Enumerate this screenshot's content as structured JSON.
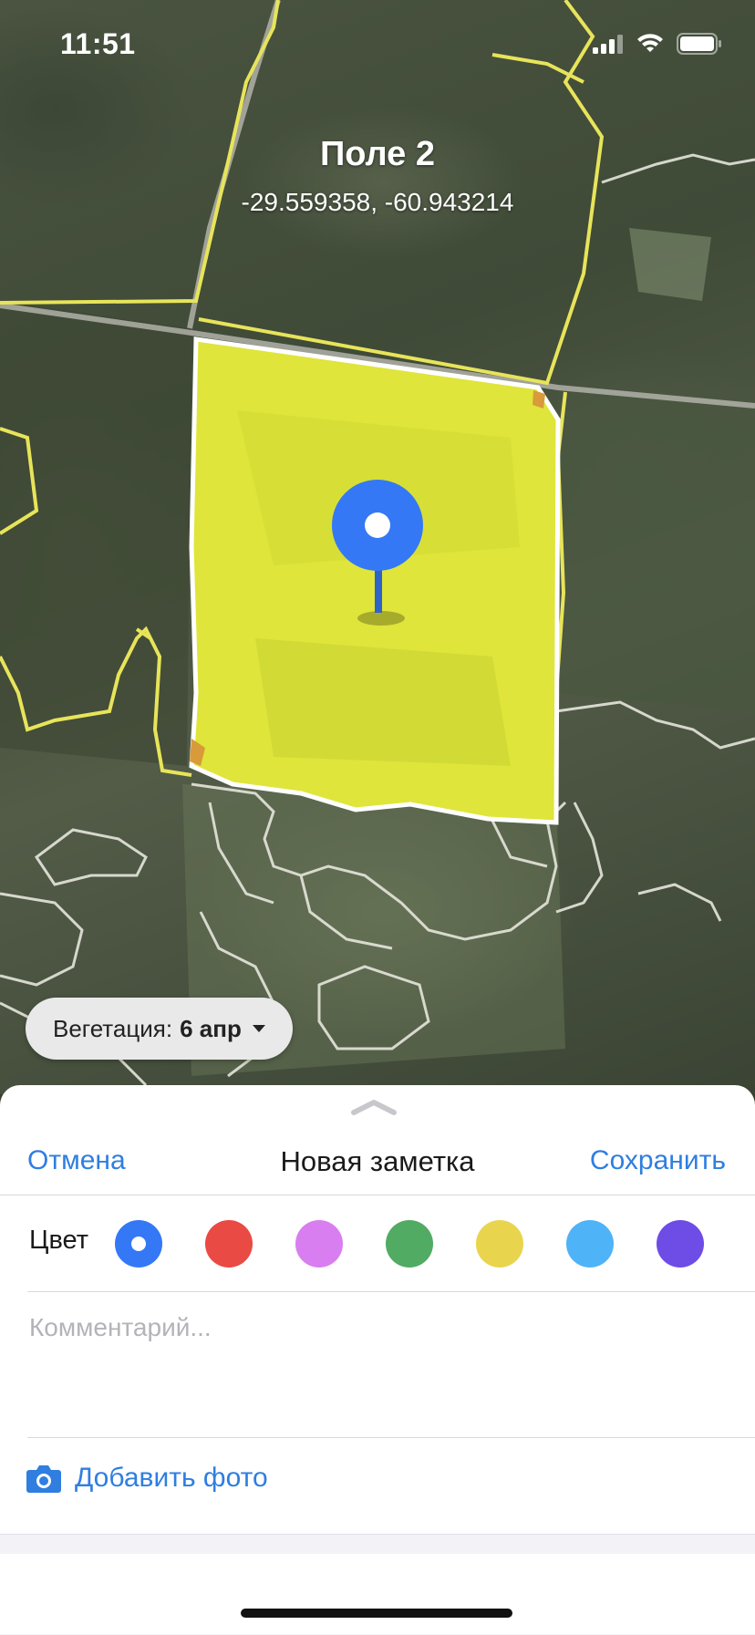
{
  "status_bar": {
    "time": "11:51"
  },
  "map": {
    "field_name": "Поле 2",
    "coordinates": "-29.559358, -60.943214",
    "vegetation_label": "Вегетация:",
    "vegetation_date": "6 апр"
  },
  "sheet": {
    "cancel_label": "Отмена",
    "title": "Новая заметка",
    "save_label": "Сохранить",
    "color_label": "Цвет",
    "colors": [
      "#3478f6",
      "#e94a43",
      "#d97ef0",
      "#52ab63",
      "#e9d44e",
      "#4fb3f7",
      "#6e4ce6"
    ],
    "selected_color_index": 0,
    "comment_placeholder": "Комментарий...",
    "add_photo_label": "Добавить фото"
  },
  "colors": {
    "accent": "#2f7ee0",
    "pin": "#3478f6",
    "field_highlight": "#dfe53a"
  }
}
